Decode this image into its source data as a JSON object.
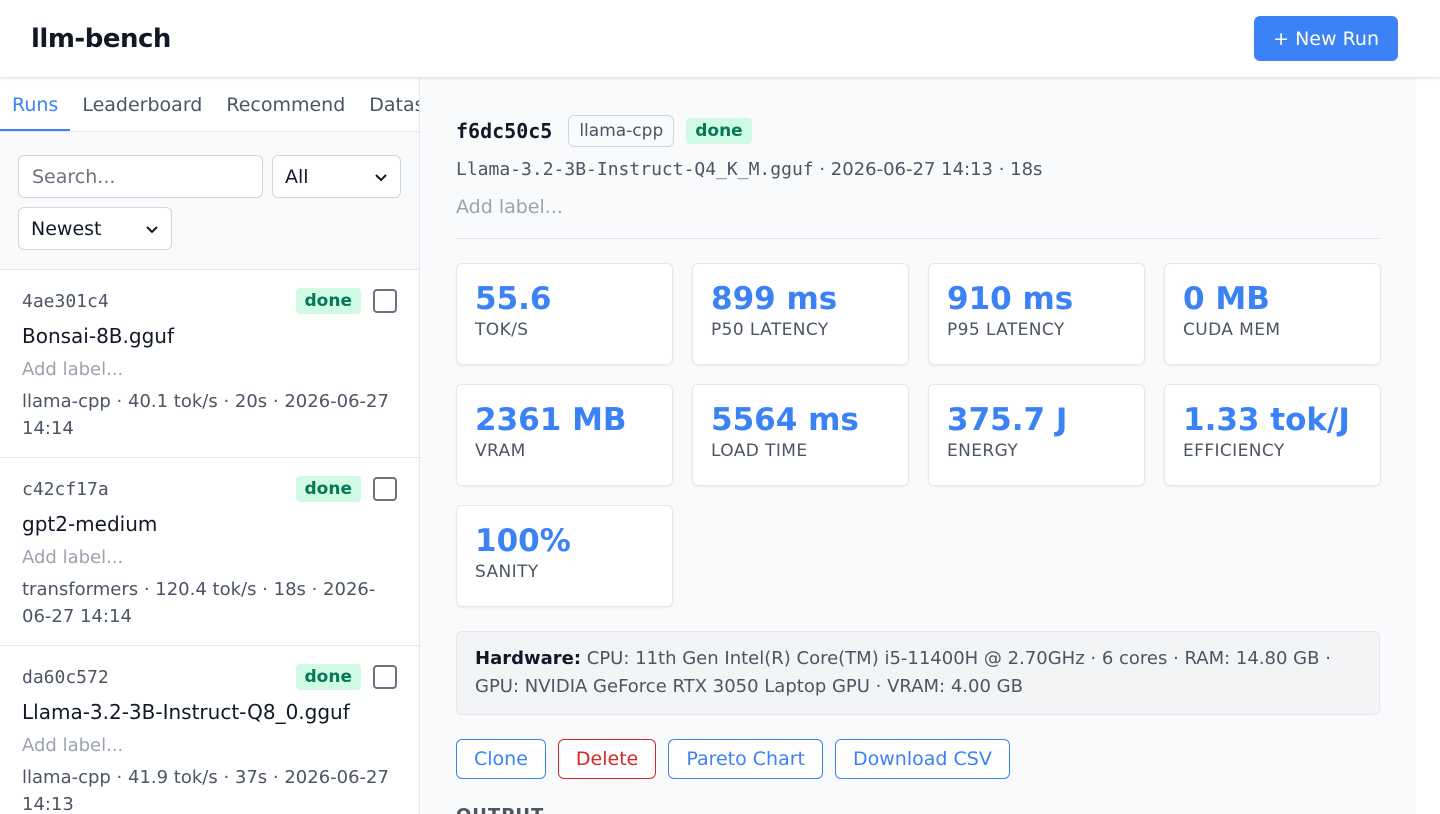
{
  "app": {
    "title": "llm-bench",
    "new_run_label": "+ New Run"
  },
  "sidebar": {
    "tabs": [
      {
        "label": "Runs",
        "active": true
      },
      {
        "label": "Leaderboard",
        "active": false
      },
      {
        "label": "Recommend",
        "active": false
      },
      {
        "label": "Datasets",
        "active": false
      }
    ],
    "search_placeholder": "Search...",
    "status_filter": "All",
    "sort": "Newest",
    "runs": [
      {
        "id": "4ae301c4",
        "status": "done",
        "name": "Bonsai-8B.gguf",
        "label_placeholder": "Add label...",
        "meta": "llama-cpp · 40.1 tok/s · 20s · 2026-06-27 14:14"
      },
      {
        "id": "c42cf17a",
        "status": "done",
        "name": "gpt2-medium",
        "label_placeholder": "Add label...",
        "meta": "transformers · 120.4 tok/s · 18s · 2026-06-27 14:14"
      },
      {
        "id": "da60c572",
        "status": "done",
        "name": "Llama-3.2-3B-Instruct-Q8_0.gguf",
        "label_placeholder": "Add label...",
        "meta": "llama-cpp · 41.9 tok/s · 37s · 2026-06-27 14:13"
      }
    ]
  },
  "detail": {
    "id": "f6dc50c5",
    "backend": "llama-cpp",
    "status": "done",
    "model": "Llama-3.2-3B-Instruct-Q4_K_M.gguf",
    "sub_meta": " · 2026-06-27 14:13 · 18s",
    "label_placeholder": "Add label...",
    "metrics": [
      {
        "value": "55.6",
        "label": "TOK/S"
      },
      {
        "value": "899 ms",
        "label": "P50 LATENCY"
      },
      {
        "value": "910 ms",
        "label": "P95 LATENCY"
      },
      {
        "value": "0 MB",
        "label": "CUDA MEM"
      },
      {
        "value": "2361 MB",
        "label": "VRAM"
      },
      {
        "value": "5564 ms",
        "label": "LOAD TIME"
      },
      {
        "value": "375.7 J",
        "label": "ENERGY"
      },
      {
        "value": "1.33 tok/J",
        "label": "EFFICIENCY"
      },
      {
        "value": "100%",
        "label": "SANITY"
      }
    ],
    "hardware_label": "Hardware:",
    "hardware_text": " CPU: 11th Gen Intel(R) Core(TM) i5-11400H @ 2.70GHz · 6 cores · RAM: 14.80 GB · GPU: NVIDIA GeForce RTX 3050 Laptop GPU · VRAM: 4.00 GB",
    "actions": {
      "clone": "Clone",
      "delete": "Delete",
      "pareto": "Pareto Chart",
      "csv": "Download CSV"
    },
    "output_heading": "OUTPUT"
  },
  "colors": {
    "accent": "#3b82f6",
    "success_bg": "#d1fae5",
    "success_text": "#047857",
    "danger": "#dc2626"
  }
}
